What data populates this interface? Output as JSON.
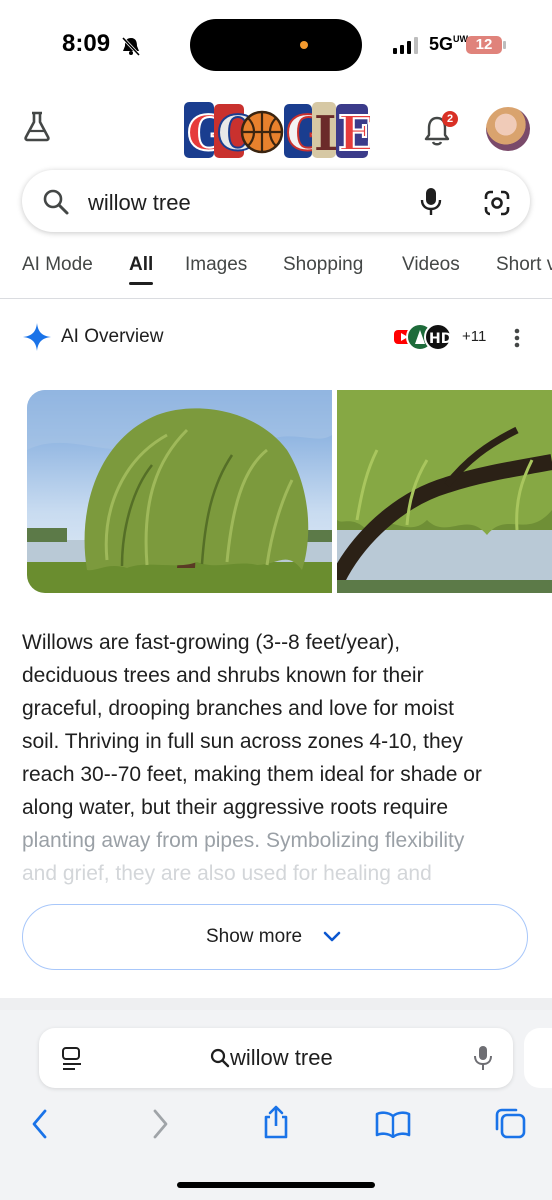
{
  "status_bar": {
    "time": "8:09",
    "network": "5G",
    "network_sup": "UW",
    "battery": "12"
  },
  "header": {
    "logo_letters": "GOOGLE",
    "notification_count": "2"
  },
  "search": {
    "query": "willow tree"
  },
  "tabs": [
    {
      "label": "AI Mode"
    },
    {
      "label": "All",
      "active": true
    },
    {
      "label": "Images"
    },
    {
      "label": "Shopping"
    },
    {
      "label": "Videos"
    },
    {
      "label": "Short v"
    }
  ],
  "ai_overview": {
    "title": "AI Overview",
    "source_count": "+11",
    "summary_lines": [
      "Willows are fast-growing (3--8 feet/year),",
      "deciduous trees and shrubs known for their",
      "graceful, drooping branches and love for moist",
      "soil. Thriving in full sun across zones 4-10, they",
      "reach 30--70 feet, making them ideal for shade or",
      "along water, but their aggressive roots require",
      "planting away from pipes. Symbolizing flexibility",
      "and grief, they are also used for healing and"
    ],
    "show_more_label": "Show more"
  },
  "browser": {
    "address_text": "willow tree"
  },
  "colors": {
    "accent_blue": "#0b57d0",
    "badge_red": "#d93025",
    "show_more_border": "#a8c7fa"
  }
}
